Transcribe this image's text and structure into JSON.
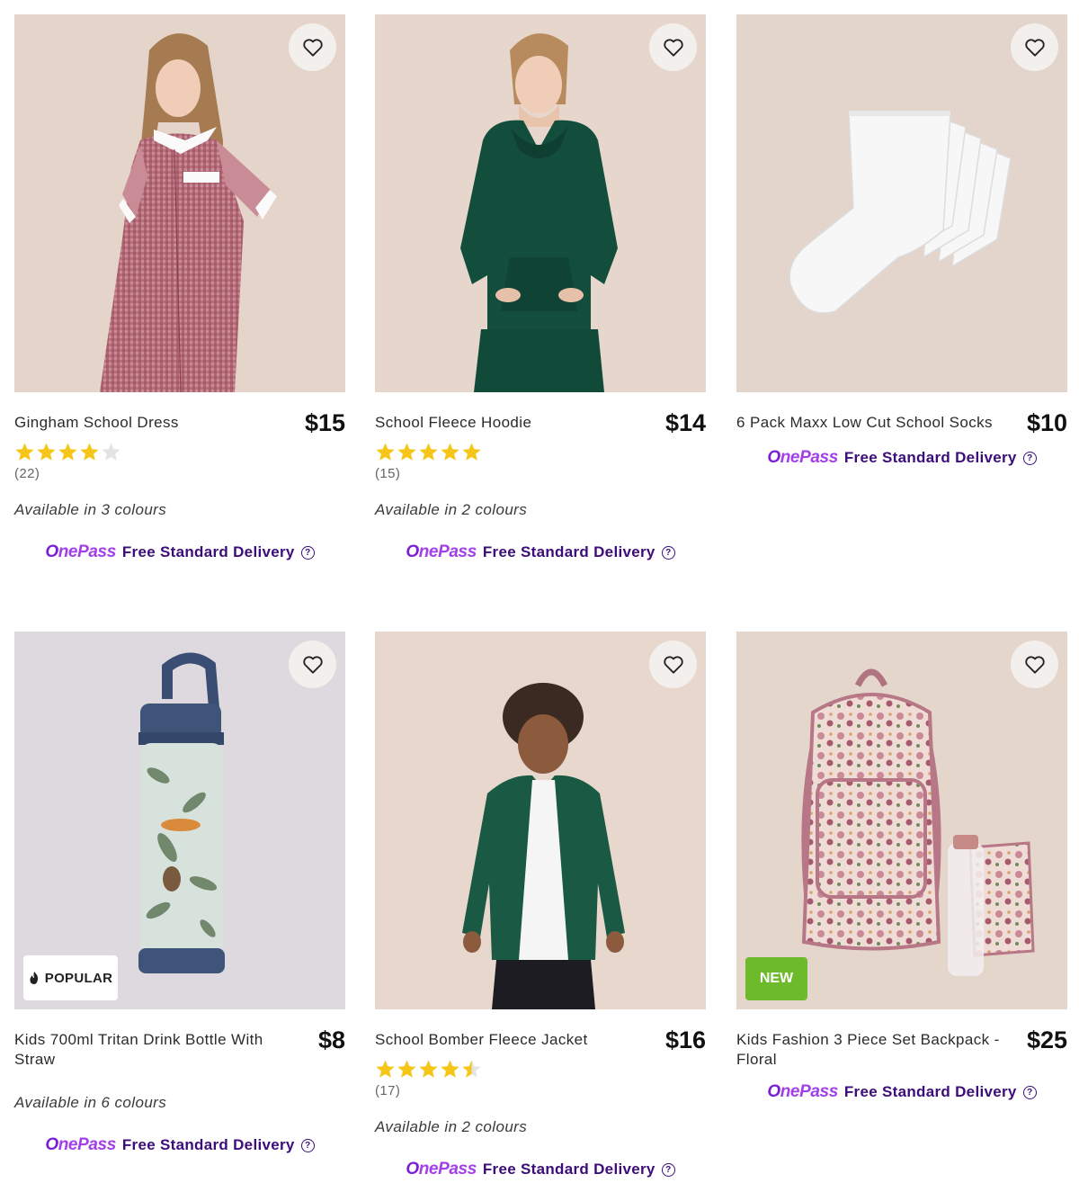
{
  "delivery": {
    "logo_o": "O",
    "logo_rest": "nePass",
    "text": "Free Standard Delivery",
    "help": "?"
  },
  "colors": {
    "onepass_purple": "#7b1fd4",
    "delivery_text": "#3c0d7a",
    "star": "#f5c518",
    "new_badge": "#6dbb2b"
  },
  "products": [
    {
      "name": "Gingham School Dress",
      "price": "$15",
      "rating": 4,
      "reviews": "(22)",
      "colours": "Available in 3 colours"
    },
    {
      "name": "School Fleece Hoodie",
      "price": "$14",
      "rating": 5,
      "reviews": "(15)",
      "colours": "Available in 2 colours"
    },
    {
      "name": "6 Pack Maxx Low Cut School Socks",
      "price": "$10"
    },
    {
      "name": "Kids 700ml Tritan Drink Bottle With Straw",
      "price": "$8",
      "badge": "POPULAR",
      "colours": "Available in 6 colours"
    },
    {
      "name": "School Bomber Fleece Jacket",
      "price": "$16",
      "rating": 4.5,
      "reviews": "(17)",
      "colours": "Available in 2 colours"
    },
    {
      "name": "Kids Fashion 3 Piece Set Backpack - Floral",
      "price": "$25",
      "badge": "NEW"
    }
  ]
}
